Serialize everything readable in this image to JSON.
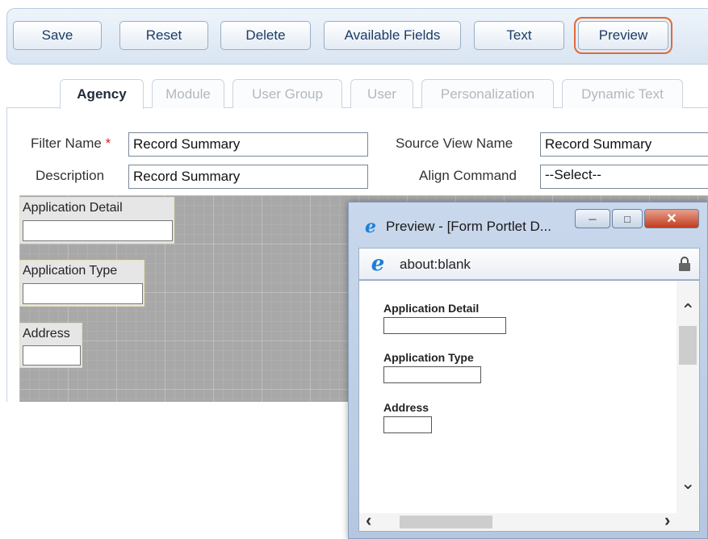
{
  "toolbar": {
    "buttons": [
      "Save",
      "Reset",
      "Delete",
      "Available Fields",
      "Text",
      "Preview"
    ]
  },
  "tabs": [
    "Agency",
    "Module",
    "User Group",
    "User",
    "Personalization",
    "Dynamic Text"
  ],
  "form": {
    "filter_name_label": "Filter Name",
    "required_mark": "*",
    "filter_name_value": "Record Summary",
    "description_label": "Description",
    "description_value": "Record Summary",
    "source_view_label": "Source View Name",
    "source_view_value": "Record Summary",
    "align_command_label": "Align Command",
    "align_command_value": "--Select--"
  },
  "designer": {
    "fields": [
      "Application Detail",
      "Application Type",
      "Address"
    ]
  },
  "preview_window": {
    "title": "Preview - [Form Portlet D...",
    "address": "about:blank",
    "fields": [
      "Application Detail",
      "Application Type",
      "Address"
    ]
  },
  "colors": {
    "highlight": "#e06a3a",
    "brand_blue": "#1a3c66"
  },
  "icons": [
    "ie-icon",
    "lock-icon",
    "minimize-icon",
    "maximize-icon",
    "close-icon"
  ]
}
